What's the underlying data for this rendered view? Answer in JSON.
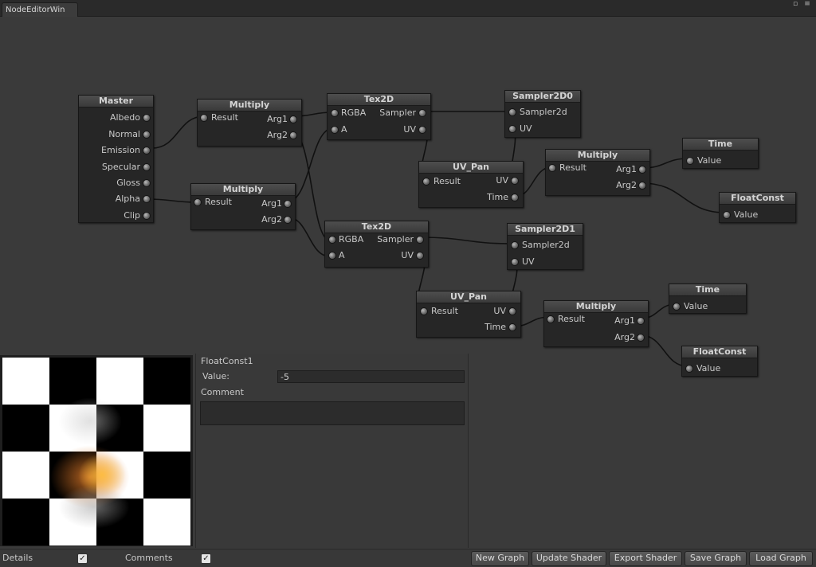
{
  "window": {
    "tab_title": "NodeEditorWin",
    "maximize_icon": "maximize-icon",
    "menu_icon": "menu-icon"
  },
  "colors": {
    "background": "#3a3a3a",
    "node_body": "#262626",
    "wire": "#111111"
  },
  "nodes": {
    "master": {
      "title": "Master",
      "inputs": [
        "Albedo",
        "Normal",
        "Emission",
        "Specular",
        "Gloss",
        "Alpha",
        "Clip"
      ]
    },
    "multiply_a": {
      "title": "Multiply",
      "output": "Result",
      "inputs": [
        "Arg1",
        "Arg2"
      ]
    },
    "multiply_b": {
      "title": "Multiply",
      "output": "Result",
      "inputs": [
        "Arg1",
        "Arg2"
      ]
    },
    "tex2d_a": {
      "title": "Tex2D",
      "left": [
        "RGBA",
        "A"
      ],
      "right": [
        "Sampler",
        "UV"
      ]
    },
    "tex2d_b": {
      "title": "Tex2D",
      "left": [
        "RGBA",
        "A"
      ],
      "right": [
        "Sampler",
        "UV"
      ]
    },
    "sampler0": {
      "title": "Sampler2D0",
      "outputs": [
        "Sampler2d",
        "UV"
      ]
    },
    "sampler1": {
      "title": "Sampler2D1",
      "outputs": [
        "Sampler2d",
        "UV"
      ]
    },
    "uvpan_a": {
      "title": "UV_Pan",
      "output": "Result",
      "inputs": [
        "UV",
        "Time"
      ]
    },
    "uvpan_b": {
      "title": "UV_Pan",
      "output": "Result",
      "inputs": [
        "UV",
        "Time"
      ]
    },
    "multiply_c": {
      "title": "Multiply",
      "output": "Result",
      "inputs": [
        "Arg1",
        "Arg2"
      ]
    },
    "multiply_d": {
      "title": "Multiply",
      "output": "Result",
      "inputs": [
        "Arg1",
        "Arg2"
      ]
    },
    "time_a": {
      "title": "Time",
      "output": "Value"
    },
    "time_b": {
      "title": "Time",
      "output": "Value"
    },
    "floatconst_a": {
      "title": "FloatConst",
      "output": "Value"
    },
    "floatconst_b": {
      "title": "FloatConst",
      "output": "Value"
    }
  },
  "inspector": {
    "node_name": "FloatConst1",
    "value_label": "Value:",
    "value": "-5",
    "comment_label": "Comment",
    "comment_value": ""
  },
  "bottom": {
    "details_label": "Details",
    "details_checked": true,
    "comments_label": "Comments",
    "comments_checked": true,
    "buttons": [
      "New Graph",
      "Update Shader",
      "Export Shader",
      "Save Graph",
      "Load Graph"
    ]
  }
}
